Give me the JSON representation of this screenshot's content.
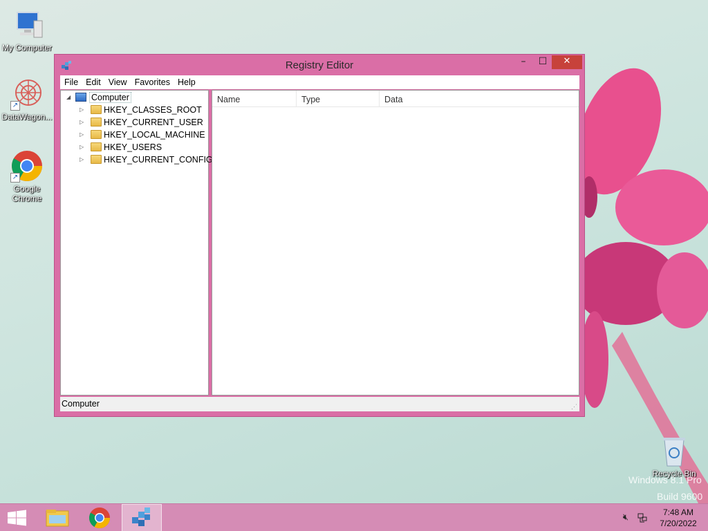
{
  "desktop": {
    "icons": [
      {
        "label": "My Computer",
        "icon": "computer-icon"
      },
      {
        "label": "DataWagon...",
        "icon": "datawagon-icon"
      },
      {
        "label": "Google Chrome",
        "icon": "chrome-icon"
      },
      {
        "label": "Recycle Bin",
        "icon": "recycle-bin-icon"
      }
    ],
    "watermark": {
      "line1": "Windows 8.1 Pro",
      "line2": "Build 9600"
    }
  },
  "window": {
    "title": "Registry Editor",
    "controls": {
      "minimize": "–",
      "maximize": "☐",
      "close": "✕"
    },
    "menu": [
      "File",
      "Edit",
      "View",
      "Favorites",
      "Help"
    ],
    "tree": {
      "root": "Computer",
      "keys": [
        "HKEY_CLASSES_ROOT",
        "HKEY_CURRENT_USER",
        "HKEY_LOCAL_MACHINE",
        "HKEY_USERS",
        "HKEY_CURRENT_CONFIG"
      ]
    },
    "list": {
      "columns": [
        "Name",
        "Type",
        "Data"
      ]
    },
    "status": "Computer"
  },
  "taskbar": {
    "clock_time": "7:48 AM",
    "clock_date": "7/20/2022",
    "apps": [
      "file-explorer-icon",
      "chrome-icon",
      "regedit-icon"
    ]
  },
  "colors": {
    "window_frame": "#da6ea6",
    "taskbar": "#d58cb5",
    "close_button": "#c7423b"
  }
}
